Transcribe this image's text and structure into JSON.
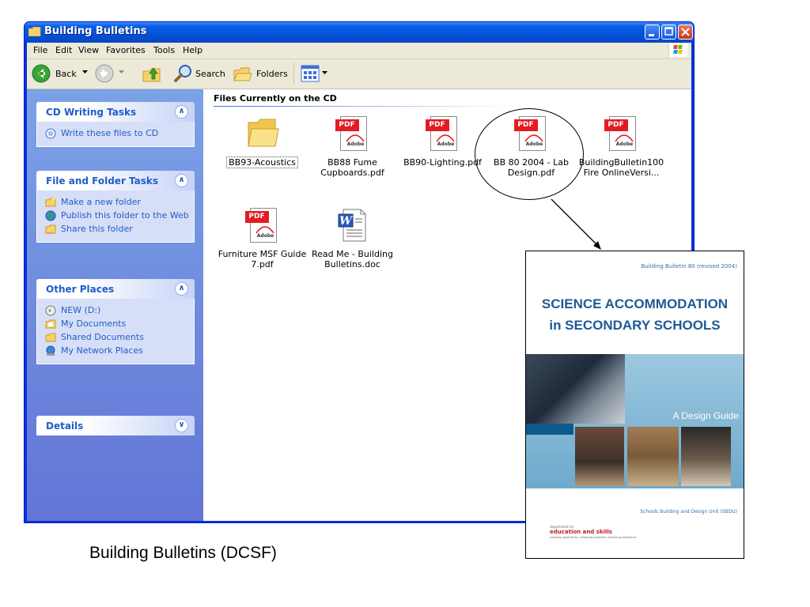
{
  "window": {
    "title": "Building Bulletins",
    "menu": [
      "File",
      "Edit",
      "View",
      "Favorites",
      "Tools",
      "Help"
    ],
    "toolbar": {
      "back": "Back",
      "search": "Search",
      "folders": "Folders"
    }
  },
  "taskpane": {
    "cd_tasks": {
      "title": "CD Writing Tasks",
      "items": [
        "Write these files to CD"
      ]
    },
    "file_tasks": {
      "title": "File and Folder Tasks",
      "items": [
        "Make a new folder",
        "Publish this folder to the Web",
        "Share this folder"
      ]
    },
    "other_places": {
      "title": "Other Places",
      "items": [
        "NEW (D:)",
        "My Documents",
        "Shared Documents",
        "My Network Places"
      ]
    },
    "details": {
      "title": "Details"
    }
  },
  "files": {
    "group_header": "Files Currently on the CD",
    "items": [
      {
        "name": "BB93-Acoustics",
        "type": "folder"
      },
      {
        "name": "BB88 Fume Cupboards.pdf",
        "type": "pdf"
      },
      {
        "name": "BB90-Lighting.pdf",
        "type": "pdf"
      },
      {
        "name": "BB 80 2004 - Lab Design.pdf",
        "type": "pdf"
      },
      {
        "name": "BuildingBulletin100 Fire OnlineVersi...",
        "type": "pdf"
      },
      {
        "name": "Furniture MSF Guide 7.pdf",
        "type": "pdf"
      },
      {
        "name": "Read Me - Building Bulletins.doc",
        "type": "doc"
      }
    ],
    "pdf_tag": "PDF",
    "adobe_label": "Adobe"
  },
  "cover": {
    "series": "Building Bulletin 80 (revised 2004)",
    "title_line1": "SCIENCE ACCOMMODATION",
    "title_line2": "in SECONDARY SCHOOLS",
    "subtitle": "A Design Guide",
    "unit": "Schools Building and Design Unit (SBDU)",
    "dept_small": "department for",
    "dept": "education and skills",
    "dept_sub": "creating opportunity, releasing potential, achieving excellence"
  },
  "caption": "Building Bulletins (DCSF)"
}
